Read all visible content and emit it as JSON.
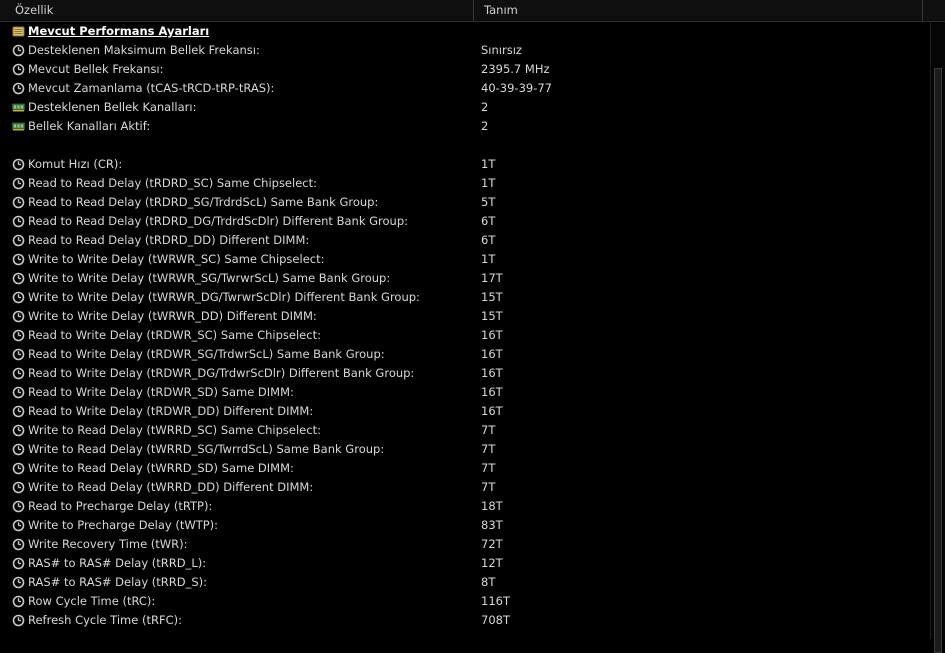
{
  "header": {
    "col_property": "Özellik",
    "col_value": "Tanım"
  },
  "section_title": "Mevcut Performans Ayarları",
  "rows": [
    {
      "icon": "clock-icon",
      "label": "Desteklenen Maksimum Bellek Frekansı:",
      "value": "Sınırsız"
    },
    {
      "icon": "clock-icon",
      "label": "Mevcut Bellek Frekansı:",
      "value": "2395.7 MHz"
    },
    {
      "icon": "clock-icon",
      "label": "Mevcut Zamanlama (tCAS-tRCD-tRP-tRAS):",
      "value": "40-39-39-77"
    },
    {
      "icon": "memory-module-icon",
      "label": "Desteklenen Bellek Kanalları:",
      "value": "2"
    },
    {
      "icon": "memory-module-icon",
      "label": "Bellek Kanalları Aktif:",
      "value": "2"
    },
    {
      "icon": "",
      "label": "",
      "value": ""
    },
    {
      "icon": "clock-icon",
      "label": "Komut Hızı (CR):",
      "value": "1T"
    },
    {
      "icon": "clock-icon",
      "label": "Read to Read Delay (tRDRD_SC) Same Chipselect:",
      "value": "1T"
    },
    {
      "icon": "clock-icon",
      "label": "Read to Read Delay (tRDRD_SG/TrdrdScL) Same Bank Group:",
      "value": "5T"
    },
    {
      "icon": "clock-icon",
      "label": "Read to Read Delay (tRDRD_DG/TrdrdScDlr) Different Bank Group:",
      "value": "6T"
    },
    {
      "icon": "clock-icon",
      "label": "Read to Read Delay (tRDRD_DD) Different DIMM:",
      "value": "6T"
    },
    {
      "icon": "clock-icon",
      "label": "Write to Write Delay (tWRWR_SC) Same Chipselect:",
      "value": "1T"
    },
    {
      "icon": "clock-icon",
      "label": "Write to Write Delay (tWRWR_SG/TwrwrScL) Same Bank Group:",
      "value": "17T"
    },
    {
      "icon": "clock-icon",
      "label": "Write to Write Delay (tWRWR_DG/TwrwrScDlr) Different Bank Group:",
      "value": "15T"
    },
    {
      "icon": "clock-icon",
      "label": "Write to Write Delay (tWRWR_DD) Different DIMM:",
      "value": "15T"
    },
    {
      "icon": "clock-icon",
      "label": "Read to Write Delay (tRDWR_SC) Same Chipselect:",
      "value": "16T"
    },
    {
      "icon": "clock-icon",
      "label": "Read to Write Delay (tRDWR_SG/TrdwrScL) Same Bank Group:",
      "value": "16T"
    },
    {
      "icon": "clock-icon",
      "label": "Read to Write Delay (tRDWR_DG/TrdwrScDlr) Different Bank Group:",
      "value": "16T"
    },
    {
      "icon": "clock-icon",
      "label": "Read to Write Delay (tRDWR_SD) Same DIMM:",
      "value": "16T"
    },
    {
      "icon": "clock-icon",
      "label": "Read to Write Delay (tRDWR_DD) Different DIMM:",
      "value": "16T"
    },
    {
      "icon": "clock-icon",
      "label": "Write to Read Delay (tWRRD_SC) Same Chipselect:",
      "value": "7T"
    },
    {
      "icon": "clock-icon",
      "label": "Write to Read Delay (tWRRD_SG/TwrrdScL) Same Bank Group:",
      "value": "7T"
    },
    {
      "icon": "clock-icon",
      "label": "Write to Read Delay (tWRRD_SD) Same DIMM:",
      "value": "7T"
    },
    {
      "icon": "clock-icon",
      "label": "Write to Read Delay (tWRRD_DD) Different DIMM:",
      "value": "7T"
    },
    {
      "icon": "clock-icon",
      "label": "Read to Precharge Delay (tRTP):",
      "value": "18T"
    },
    {
      "icon": "clock-icon",
      "label": "Write to Precharge Delay (tWTP):",
      "value": "83T"
    },
    {
      "icon": "clock-icon",
      "label": "Write Recovery Time (tWR):",
      "value": "72T"
    },
    {
      "icon": "clock-icon",
      "label": "RAS# to RAS# Delay (tRRD_L):",
      "value": "12T"
    },
    {
      "icon": "clock-icon",
      "label": "RAS# to RAS# Delay (tRRD_S):",
      "value": "8T"
    },
    {
      "icon": "clock-icon",
      "label": "Row Cycle Time (tRC):",
      "value": "116T"
    },
    {
      "icon": "clock-icon",
      "label": "Refresh Cycle Time (tRFC):",
      "value": "708T"
    }
  ],
  "colors": {
    "background": "#000000",
    "text": "#d8d8d8",
    "title_text": "#ffffff",
    "header_bg": "#0f0f0f"
  }
}
